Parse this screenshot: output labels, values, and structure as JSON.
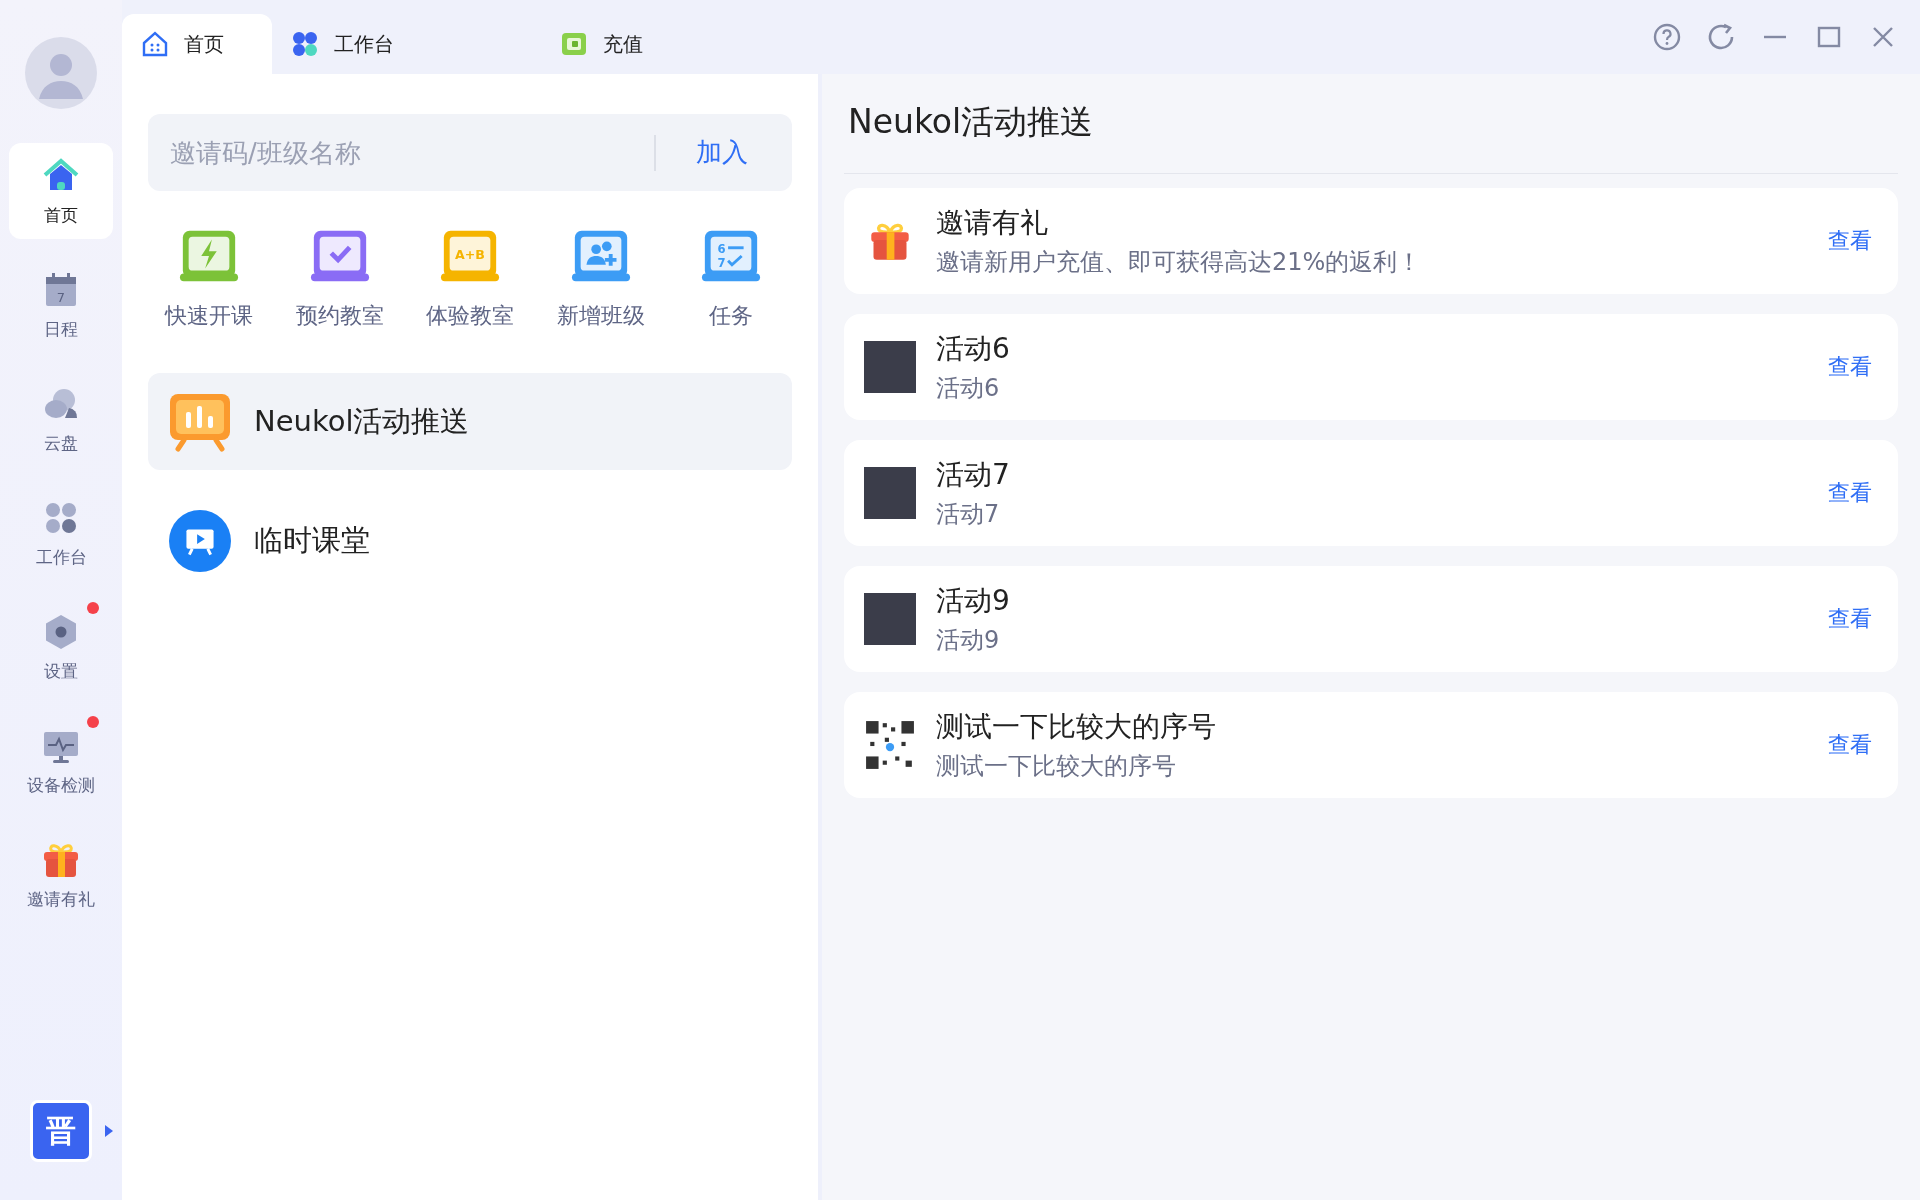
{
  "sidebar": {
    "items": [
      {
        "label": "首页",
        "kind": "home",
        "selected": true,
        "badge": false
      },
      {
        "label": "日程",
        "kind": "calendar",
        "icon_text": "7",
        "selected": false,
        "badge": false
      },
      {
        "label": "云盘",
        "kind": "cloud",
        "selected": false,
        "badge": false
      },
      {
        "label": "工作台",
        "kind": "grid",
        "selected": false,
        "badge": false
      },
      {
        "label": "设置",
        "kind": "settings",
        "selected": false,
        "badge": true
      },
      {
        "label": "设备检测",
        "kind": "monitor",
        "selected": false,
        "badge": true
      },
      {
        "label": "邀请有礼",
        "kind": "gift",
        "selected": false,
        "badge": false
      }
    ],
    "logo": "晋"
  },
  "tabs": [
    {
      "label": "首页",
      "kind": "home",
      "selected": true
    },
    {
      "label": "工作台",
      "kind": "grid",
      "selected": false
    },
    {
      "label": "充值",
      "kind": "wallet",
      "selected": false
    }
  ],
  "join": {
    "placeholder": "邀请码/班级名称",
    "button": "加入"
  },
  "quick_actions": [
    {
      "label": "快速开课",
      "kind": "bolt"
    },
    {
      "label": "预约教室",
      "kind": "check"
    },
    {
      "label": "体验教室",
      "kind": "ab",
      "icon_text": "A+B"
    },
    {
      "label": "新增班级",
      "kind": "users"
    },
    {
      "label": "任务",
      "kind": "task",
      "icon_text": "6",
      "icon_text2": "7"
    }
  ],
  "menu": [
    {
      "label": "Neukol活动推送",
      "kind": "board",
      "selected": true
    },
    {
      "label": "临时课堂",
      "kind": "play",
      "selected": false
    }
  ],
  "panel": {
    "title": "Neukol活动推送",
    "items": [
      {
        "title": "邀请有礼",
        "subtitle": "邀请新用户充值、即可获得高达21%的返利！",
        "kind": "gift",
        "action": "查看"
      },
      {
        "title": "活动6",
        "subtitle": "活动6",
        "kind": "photo",
        "action": "查看"
      },
      {
        "title": "活动7",
        "subtitle": "活动7",
        "kind": "photo",
        "action": "查看"
      },
      {
        "title": "活动9",
        "subtitle": "活动9",
        "kind": "photo",
        "action": "查看"
      },
      {
        "title": "测试一下比较大的序号",
        "subtitle": "测试一下比较大的序号",
        "kind": "qr",
        "action": "查看"
      }
    ]
  }
}
